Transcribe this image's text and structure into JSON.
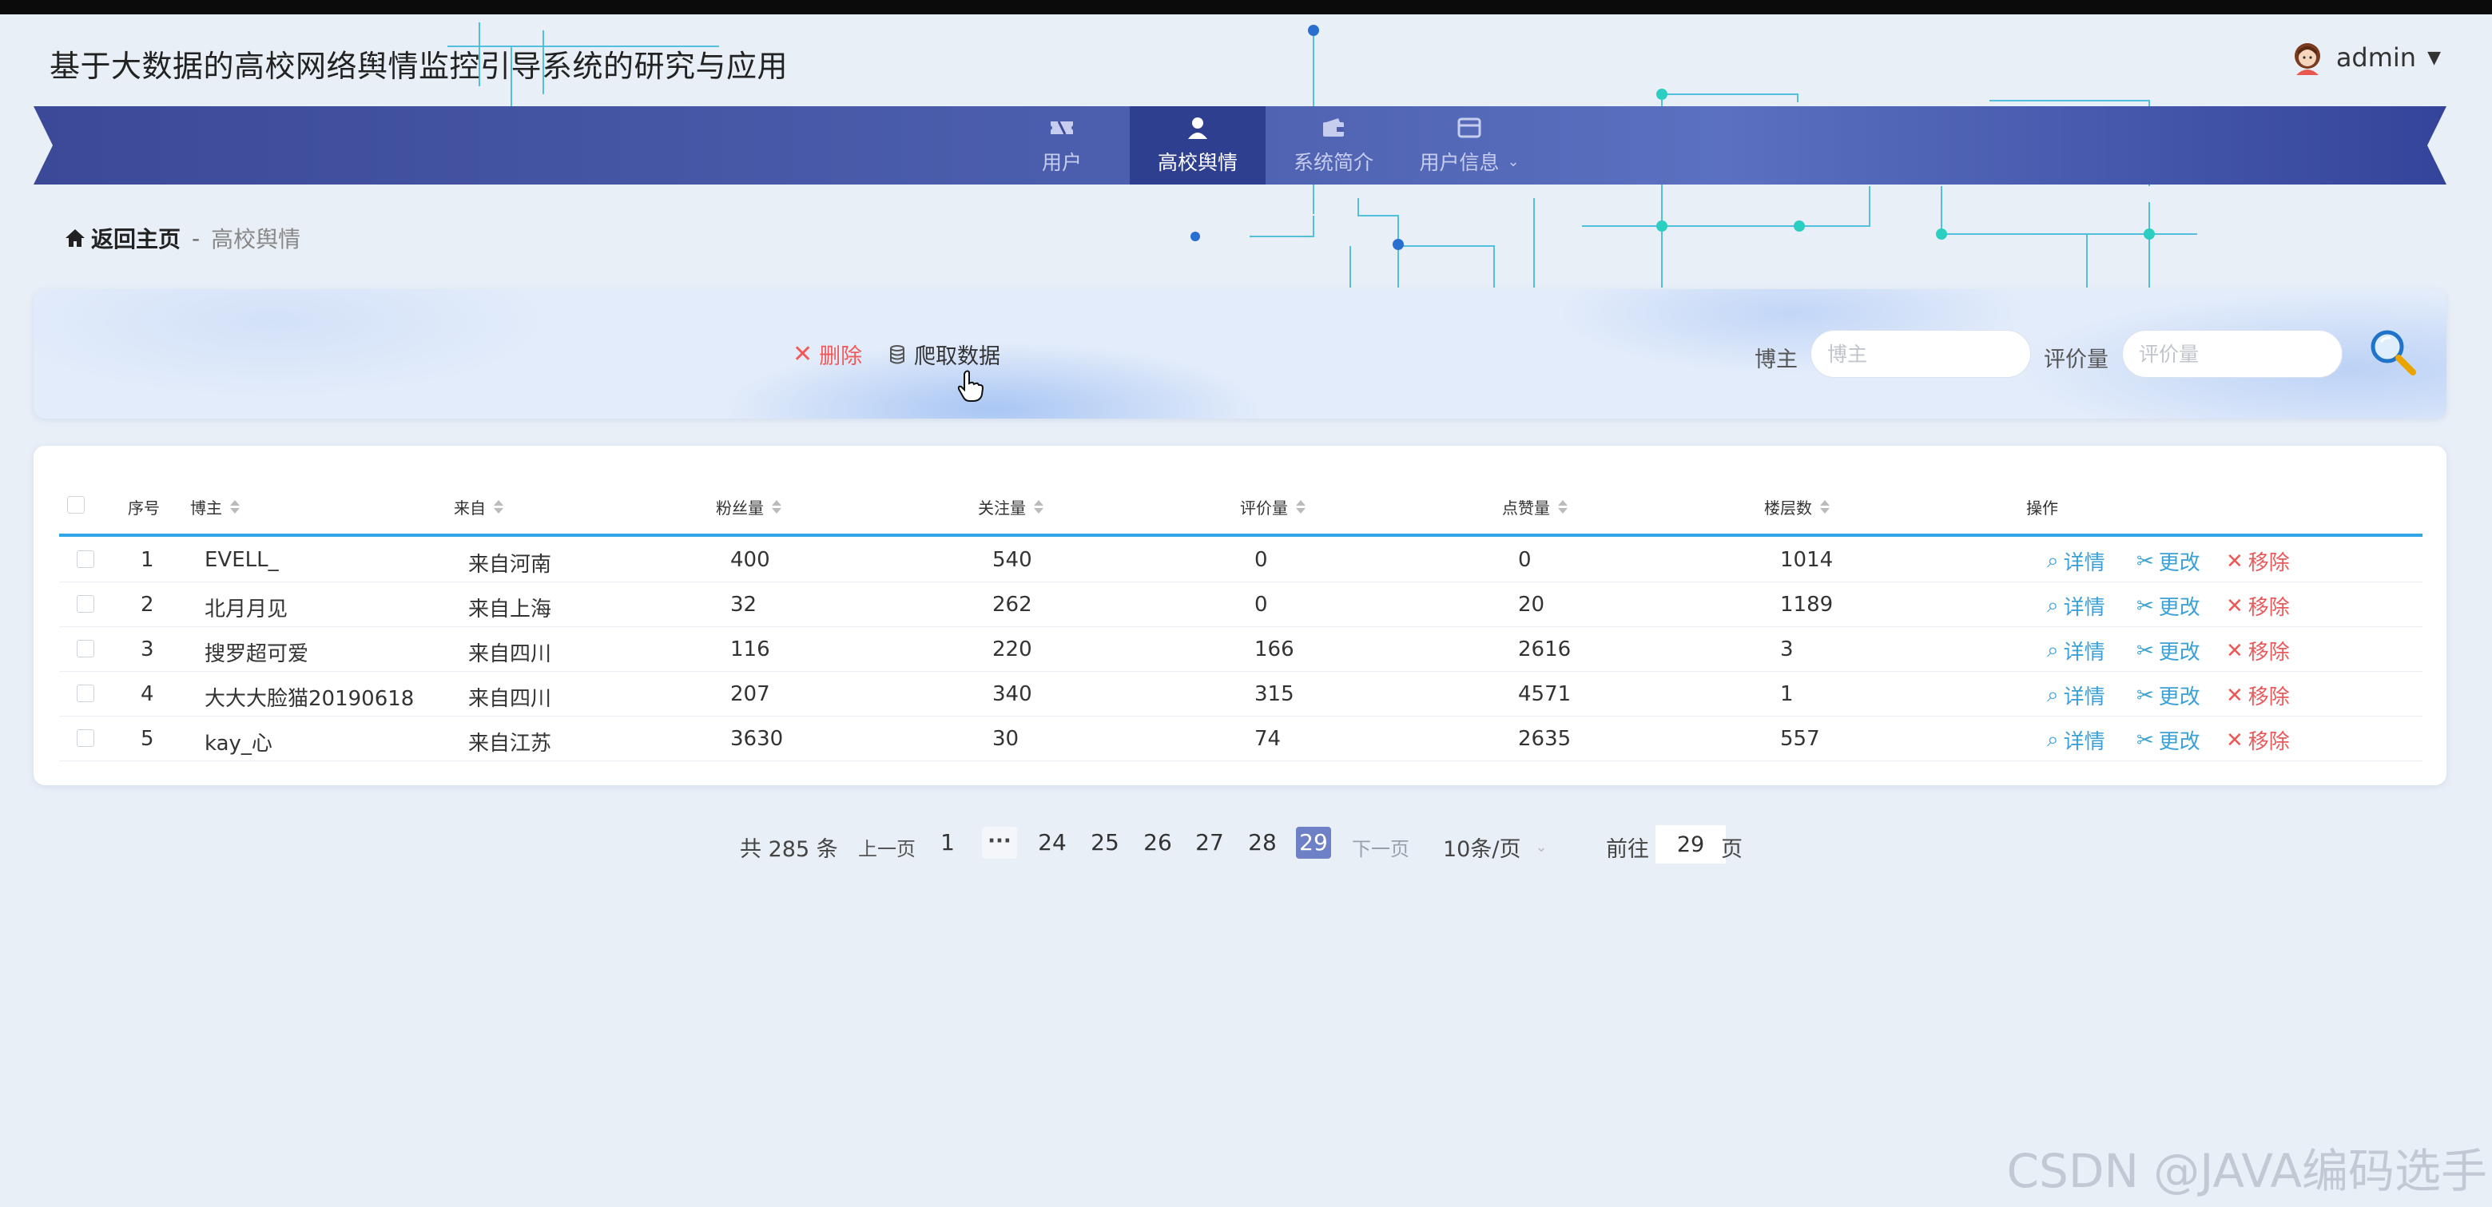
{
  "app_title": "基于大数据的高校网络舆情监控引导系统的研究与应用",
  "user": {
    "name": "admin"
  },
  "nav": {
    "items": [
      {
        "label": "用户",
        "icon": "ticket-icon"
      },
      {
        "label": "高校舆情",
        "icon": "user-icon",
        "active": true
      },
      {
        "label": "系统简介",
        "icon": "wallet-icon"
      },
      {
        "label": "用户信息",
        "icon": "card-icon"
      }
    ]
  },
  "breadcrumb": {
    "home": "返回主页",
    "separator": "-",
    "current": "高校舆情"
  },
  "toolbar": {
    "delete_label": "删除",
    "crawl_label": "爬取数据",
    "filter_blogger_label": "博主",
    "filter_blogger_placeholder": "博主",
    "filter_comments_label": "评价量",
    "filter_comments_placeholder": "评价量"
  },
  "table": {
    "columns": [
      "序号",
      "博主",
      "来自",
      "粉丝量",
      "关注量",
      "评价量",
      "点赞量",
      "楼层数",
      "操作"
    ],
    "actions": {
      "detail": "详情",
      "edit": "更改",
      "remove": "移除"
    },
    "rows": [
      {
        "index": "1",
        "blogger": "EVELL_",
        "from": "来自河南",
        "fans": "400",
        "follows": "540",
        "comments": "0",
        "likes": "0",
        "floors": "1014"
      },
      {
        "index": "2",
        "blogger": "北月月见",
        "from": "来自上海",
        "fans": "32",
        "follows": "262",
        "comments": "0",
        "likes": "20",
        "floors": "1189"
      },
      {
        "index": "3",
        "blogger": "搜罗超可爱",
        "from": "来自四川",
        "fans": "116",
        "follows": "220",
        "comments": "166",
        "likes": "2616",
        "floors": "3"
      },
      {
        "index": "4",
        "blogger": "大大大脸猫20190618",
        "from": "来自四川",
        "fans": "207",
        "follows": "340",
        "comments": "315",
        "likes": "4571",
        "floors": "1"
      },
      {
        "index": "5",
        "blogger": "kay_心",
        "from": "来自江苏",
        "fans": "3630",
        "follows": "30",
        "comments": "74",
        "likes": "2635",
        "floors": "557"
      }
    ]
  },
  "pagination": {
    "total": "共 285 条",
    "prev": "上一页",
    "first": "1",
    "ellipsis": "···",
    "pages": [
      "24",
      "25",
      "26",
      "27",
      "28",
      "29"
    ],
    "current": "29",
    "next": "下一页",
    "page_size": "10条/页",
    "goto_label": "前往",
    "goto_value": "29",
    "goto_suffix": "页"
  },
  "watermark": "CSDN @JAVA编码选手",
  "colors": {
    "nav_bg": "#3d4c9a",
    "nav_active": "#2f3f8f",
    "accent": "#2fa4e7",
    "danger": "#e85a5a",
    "pager_active": "#6f81c6"
  }
}
